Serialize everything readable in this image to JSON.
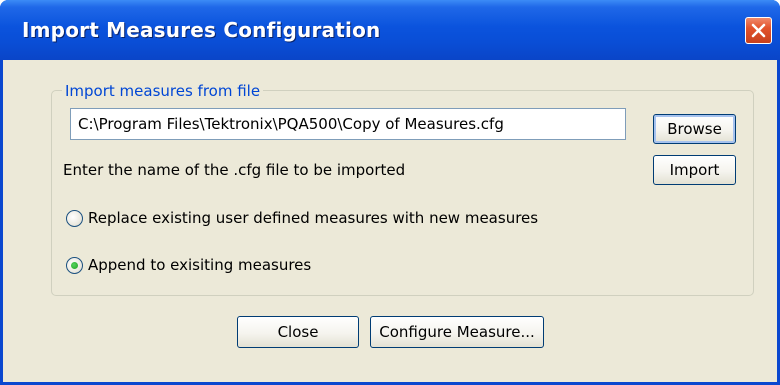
{
  "window": {
    "title": "Import Measures Configuration"
  },
  "group": {
    "label": "Import measures from file",
    "file_path_value": "C:\\Program Files\\Tektronix\\PQA500\\Copy of Measures.cfg",
    "hint": "Enter the name of the .cfg file to be imported",
    "browse_label": "Browse",
    "import_label": "Import"
  },
  "options": [
    {
      "label": "Replace existing user defined measures with new measures",
      "selected": false
    },
    {
      "label": "Append to exisiting measures",
      "selected": true
    }
  ],
  "footer": {
    "close_label": "Close",
    "configure_label": "Configure Measure..."
  },
  "colors": {
    "titlebar": "#0a4ed6",
    "dialog_bg": "#ece9d8",
    "group_label": "#0046d5",
    "radio_selected": "#21a121",
    "close_button": "#e2532c"
  },
  "icons": {
    "close": "close-icon"
  }
}
